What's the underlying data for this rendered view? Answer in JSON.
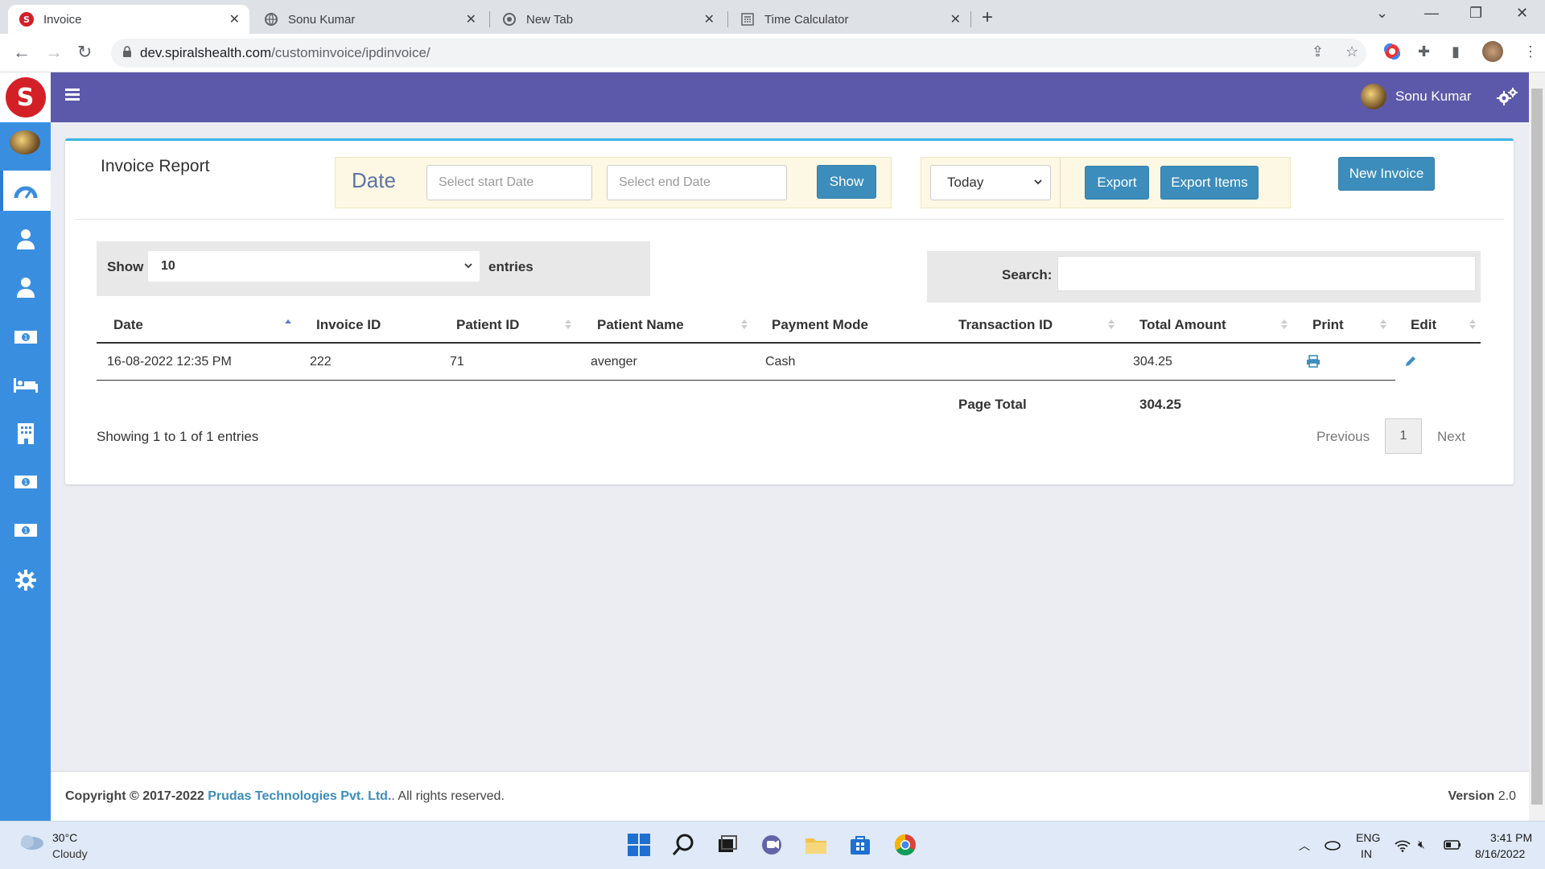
{
  "browser": {
    "tabs": [
      {
        "title": "Invoice",
        "active": true
      },
      {
        "title": "Sonu Kumar",
        "active": false
      },
      {
        "title": "New Tab",
        "active": false
      },
      {
        "title": "Time Calculator",
        "active": false
      }
    ],
    "url_host": "dev.spiralshealth.com",
    "url_path": "/custominvoice/ipdinvoice/"
  },
  "header": {
    "user_name": "Sonu Kumar",
    "brand_color": "#5d59aa"
  },
  "sidebar": {
    "color": "#3a8ee0",
    "items": [
      {
        "icon": "dashboard-icon",
        "active": true
      },
      {
        "icon": "user-icon"
      },
      {
        "icon": "user-icon"
      },
      {
        "icon": "money-icon"
      },
      {
        "icon": "bed-icon"
      },
      {
        "icon": "building-icon"
      },
      {
        "icon": "money-icon"
      },
      {
        "icon": "money-icon"
      },
      {
        "icon": "gear-icon"
      }
    ]
  },
  "report": {
    "title": "Invoice Report",
    "date_label": "Date",
    "start_placeholder": "Select start Date",
    "end_placeholder": "Select end Date",
    "show_button": "Show",
    "range_selected": "Today",
    "export_button": "Export",
    "export_items_button": "Export Items",
    "new_invoice_button": "New Invoice"
  },
  "table": {
    "length_label": "Show",
    "length_value": "10",
    "entries_label": "entries",
    "search_label": "Search:",
    "columns": [
      "Date",
      "Invoice ID",
      "Patient ID",
      "Patient Name",
      "Payment Mode",
      "Transaction ID",
      "Total Amount",
      "Print",
      "Edit"
    ],
    "rows": [
      {
        "date": "16-08-2022 12:35 PM",
        "invoice_id": "222",
        "patient_id": "71",
        "patient_name": "avenger",
        "payment_mode": "Cash",
        "transaction_id": "",
        "total_amount": "304.25"
      }
    ],
    "page_total_label": "Page Total",
    "page_total_value": "304.25",
    "info": "Showing 1 to 1 of 1 entries",
    "prev": "Previous",
    "page": "1",
    "next": "Next"
  },
  "footer": {
    "copyright_prefix": "Copyright © 2017-2022",
    "company": "Prudas Technologies Pvt. Ltd.",
    "suffix": ". All rights reserved.",
    "version_label": "Version",
    "version": "2.0"
  },
  "taskbar": {
    "temperature": "30°C",
    "weather": "Cloudy",
    "lang": "ENG",
    "region": "IN",
    "time": "3:41 PM",
    "date": "8/16/2022"
  }
}
